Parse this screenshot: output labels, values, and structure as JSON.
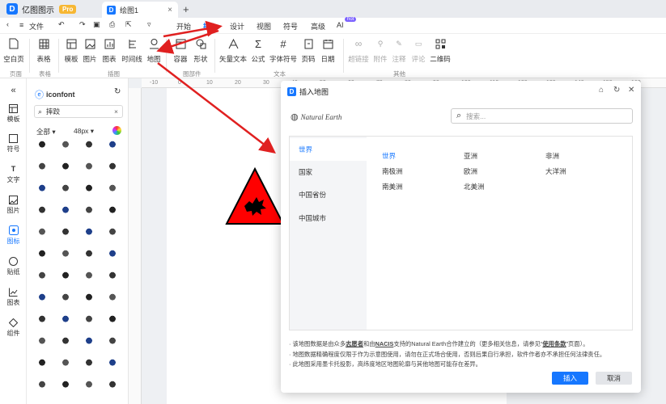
{
  "app": {
    "name": "亿图图示",
    "badge": "Pro",
    "doc_tab": "绘图1"
  },
  "menu": {
    "items": [
      "开始",
      "插入",
      "设计",
      "视图",
      "符号",
      "高级",
      "AI"
    ],
    "active": "插入",
    "hot_badge": "hot",
    "file_label": "文件"
  },
  "ribbon": {
    "buttons": [
      "空白页",
      "表格",
      "模板",
      "图片",
      "图表",
      "时间线",
      "地图",
      "容器",
      "形状",
      "矢量文本",
      "公式",
      "字体符号",
      "页码",
      "日期",
      "超链接",
      "附件",
      "注释",
      "评论",
      "二维码"
    ],
    "groups": [
      "页面",
      "表格",
      "插图",
      "图部件",
      "文本",
      "其他"
    ]
  },
  "leftbar": {
    "items": [
      "模板",
      "符号",
      "文字",
      "图片",
      "图标",
      "贴纸",
      "图表",
      "组件"
    ],
    "active": "图标"
  },
  "library": {
    "source": "iconfont",
    "search_value": "摔跤",
    "filter_all": "全部",
    "filter_size": "48px"
  },
  "ruler": {
    "ticks": [
      "-10",
      "0",
      "10",
      "20",
      "30",
      "40",
      "50",
      "60",
      "70",
      "80",
      "90",
      "100",
      "110",
      "120",
      "130",
      "140",
      "150",
      "160",
      "170",
      "180",
      "190",
      "200",
      "210",
      "220",
      "230",
      "240",
      "250",
      "260",
      "270",
      "280",
      "290",
      "300"
    ]
  },
  "dialog": {
    "title": "插入地图",
    "brand": "Natural Earth",
    "search_placeholder": "搜索...",
    "regions": [
      "世界",
      "国家",
      "中国省份",
      "中国城市"
    ],
    "selected_region": "世界",
    "continents": [
      "世界",
      "亚洲",
      "非洲",
      "南极洲",
      "欧洲",
      "大洋洲",
      "南美洲",
      "北美洲"
    ],
    "selected_continent": "世界",
    "notes": [
      {
        "pre": "· 该地图数据是由众多",
        "b1": "志愿者",
        "mid": "和由",
        "b2": "NACIS",
        "post": "支持的Natural Earth合作建立的（更多相关信息，请参见“",
        "b3": "使用条款",
        "end": "”页面）。"
      },
      {
        "text": "· 地图数据精确程度仅限于作为示意图使用，请勿在正式场合使用，否则后果自行承担，软件作者亦不承担任何法律责任。"
      },
      {
        "text": "· 此地图采用墨卡托投影，高纬度地区地图轮廓与其他地图可能存在差异。"
      }
    ],
    "ok_label": "插入",
    "cancel_label": "取消"
  },
  "colors": {
    "accent": "#1677ff",
    "arrow": "#e02020",
    "warning_fill": "#ff0000"
  }
}
